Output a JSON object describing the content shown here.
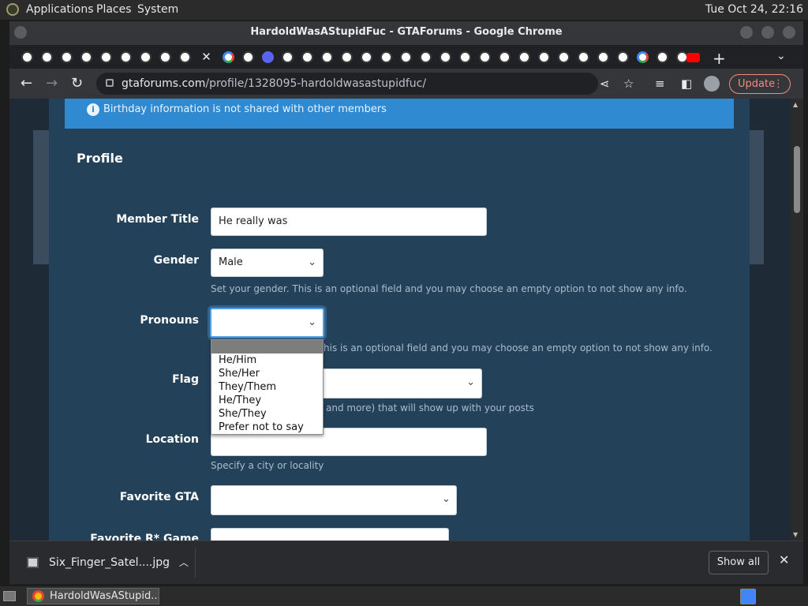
{
  "desktop": {
    "menu": [
      "Applications",
      "Places",
      "System"
    ],
    "clock": "Tue Oct 24, 22:16"
  },
  "window": {
    "title": "HardoldWasAStupidFuc - GTAForums - Google Chrome"
  },
  "toolbar": {
    "url_domain": "gtaforums.com",
    "url_path": "/profile/1328095-hardoldwasastupidfuc/",
    "update_label": "Update"
  },
  "page": {
    "alert": "Birthday information is not shared with other members",
    "section_title": "Profile",
    "member_title": {
      "label": "Member Title",
      "value": "He really was"
    },
    "gender": {
      "label": "Gender",
      "value": "Male",
      "help": "Set your gender. This is an optional field and you may choose an empty option to not show any info."
    },
    "pronouns": {
      "label": "Pronouns",
      "value": "",
      "help_visible": "his is an optional field and you may choose an empty option to not show any info.",
      "options": [
        "",
        "He/Him",
        "She/Her",
        "They/Them",
        "He/They",
        "She/They",
        "Prefer not to say"
      ]
    },
    "flag": {
      "label": "Flag",
      "help_visible": "and more) that will show up with your posts"
    },
    "location": {
      "label": "Location",
      "value": "",
      "help": "Specify a city or locality"
    },
    "favorite_gta": {
      "label": "Favorite GTA",
      "value": ""
    },
    "favorite_rstar": {
      "label": "Favorite R* Game"
    }
  },
  "downloads": {
    "file": "Six_Finger_Satel....jpg",
    "show_all": "Show all"
  },
  "taskbar": {
    "window_button": "HardoldWasAStupid..."
  }
}
